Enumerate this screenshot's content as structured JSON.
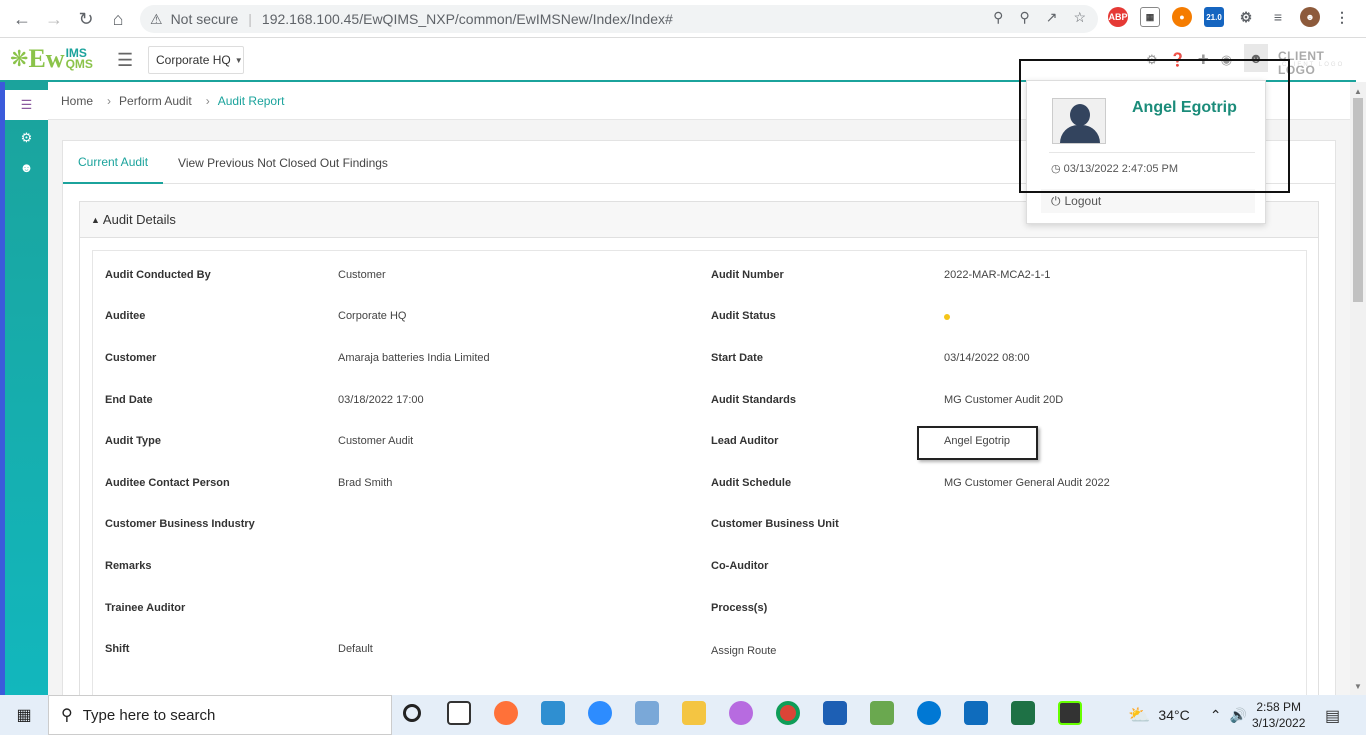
{
  "browser": {
    "security_label": "Not secure",
    "url": "192.168.100.45/EwQIMS_NXP/common/EwIMSNew/Index/Index#",
    "ext_badge": "21.0",
    "abp_label": "ABP"
  },
  "header": {
    "logo_ew": "Ew",
    "logo_ims": "IMS",
    "logo_qms": "QMS",
    "location_value": "Corporate HQ",
    "client_logo": "CLIENT LOGO",
    "client_logo_sub": "CLIENT LOGO"
  },
  "breadcrumb": {
    "home": "Home",
    "perform_audit": "Perform Audit",
    "current": "Audit Report"
  },
  "tabs": {
    "current_audit": "Current Audit",
    "previous": "View Previous Not Closed Out Findings"
  },
  "details": {
    "title": "Audit Details",
    "rows": [
      {
        "l1": "Audit Conducted By",
        "v1": "Customer",
        "l2": "Audit Number",
        "v2": "2022-MAR-MCA2-1-1"
      },
      {
        "l1": "Auditee",
        "v1": "Corporate HQ",
        "l2": "Audit Status",
        "v2": ""
      },
      {
        "l1": "Customer",
        "v1": "Amaraja batteries India Limited",
        "l2": "Start Date",
        "v2": "03/14/2022 08:00"
      },
      {
        "l1": "End Date",
        "v1": "03/18/2022 17:00",
        "l2": "Audit Standards",
        "v2": "MG Customer Audit 20D"
      },
      {
        "l1": "Audit Type",
        "v1": "Customer Audit",
        "l2": "Lead Auditor",
        "v2": "Angel Egotrip"
      },
      {
        "l1": "Auditee Contact Person",
        "v1": "Brad Smith",
        "l2": "Audit Schedule",
        "v2": "MG Customer General Audit 2022"
      },
      {
        "l1": "Customer Business Industry",
        "v1": "",
        "l2": "Customer Business Unit",
        "v2": ""
      },
      {
        "l1": "Remarks",
        "v1": "",
        "l2": "Co-Auditor",
        "v2": ""
      },
      {
        "l1": "Trainee Auditor",
        "v1": "",
        "l2": "Process(s)",
        "v2": ""
      },
      {
        "l1": "Shift",
        "v1": "Default",
        "l2": "Assign Route",
        "v2": ""
      }
    ],
    "status_color": "#f5c518"
  },
  "profile": {
    "name": "Angel Egotrip",
    "login_time": "03/13/2022 2:47:05 PM",
    "logout": "Logout"
  },
  "taskbar": {
    "search_placeholder": "Type here to search",
    "temperature": "34°C",
    "time": "2:58 PM",
    "date": "3/13/2022"
  },
  "colors": {
    "accent": "#1ba39c",
    "brand_green": "#8bc34a"
  }
}
